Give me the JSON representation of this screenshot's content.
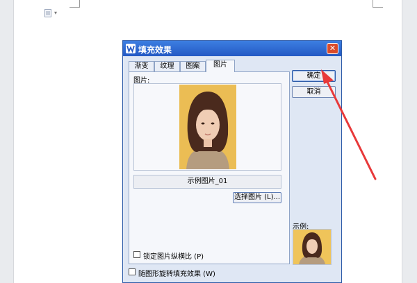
{
  "dialog": {
    "title": "填充效果",
    "tabs": [
      {
        "label": "渐变",
        "active": false
      },
      {
        "label": "纹理",
        "active": false
      },
      {
        "label": "图案",
        "active": false
      },
      {
        "label": "图片",
        "active": true
      }
    ],
    "picture_label": "图片:",
    "picture_name": "示例图片_01",
    "select_picture_label": "选择图片 (L)...",
    "lock_aspect_label": "锁定图片纵横比 (P)",
    "rotate_with_shape_label": "随图形旋转填充效果 (W)",
    "ok_label": "确定",
    "cancel_label": "取消",
    "sample_label": "示例:",
    "close_icon_glyph": "✕"
  },
  "colors": {
    "titlebar": "#2c63cf",
    "close_button": "#d94a2a",
    "annotation_arrow": "#e8393a",
    "photo_background": "#efc45a"
  }
}
